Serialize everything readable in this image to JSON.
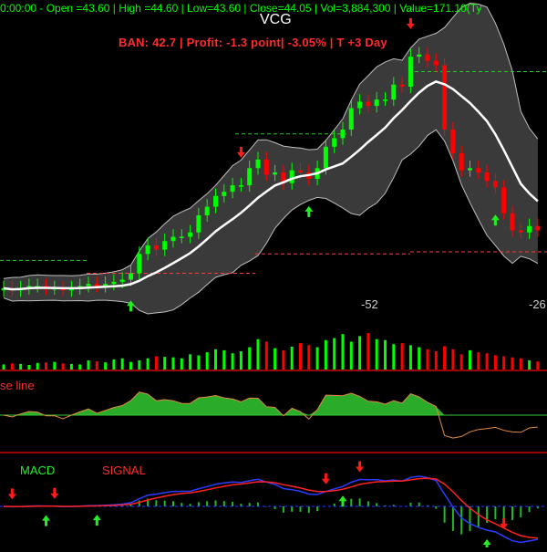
{
  "header": {
    "info_line": "0:00:00 -  Open =43.60 | High =44.60 | Low=43.60 | Close=44.05 | Vol=3,884,300 | Value=171.10(Ty",
    "symbol": "VCG",
    "signal_line": "BAN:  42.7 | Profit: -1.3 point| -3.05% | T +3 Day"
  },
  "colors": {
    "background": "#000000",
    "up_candle": "#00ff00",
    "down_candle": "#ff0000",
    "band_fill": "#3a3a3a",
    "band_edge": "#bfbfbf",
    "middle_band": "#ffffff",
    "macd_line": "#2a3cff",
    "signal_line": "#ff2020",
    "oscillator_line": "#e08a40",
    "oscillator_fill": "#2fbf2f",
    "buy_arrow": "#22ee22",
    "sell_arrow": "#ff1a1a"
  },
  "labels": {
    "base_line": "se line",
    "macd": "MACD",
    "signal": "SIGNAL",
    "annot_52": "-52",
    "annot_26": "-26"
  },
  "chart_data": {
    "type": "candlestick",
    "title": "VCG",
    "bars": 64,
    "close": [
      43.6,
      43.5,
      43.6,
      43.7,
      43.7,
      43.6,
      43.6,
      43.5,
      43.6,
      43.7,
      43.8,
      43.7,
      43.8,
      43.9,
      44.0,
      44.3,
      45.2,
      45.6,
      45.4,
      45.8,
      46.0,
      46.0,
      46.2,
      47.0,
      47.4,
      47.9,
      48.1,
      48.4,
      48.4,
      49.2,
      49.6,
      48.9,
      49.0,
      48.5,
      49.1,
      49.0,
      48.7,
      49.2,
      50.2,
      50.6,
      51.0,
      52.0,
      52.3,
      52.1,
      52.4,
      52.4,
      53.1,
      53.0,
      54.4,
      54.5,
      54.2,
      54.0,
      51.0,
      49.9,
      49.1,
      49.2,
      49.0,
      48.6,
      48.3,
      47.1,
      46.3,
      46.2,
      46.5,
      46.3
    ],
    "volume": [
      10,
      12,
      11,
      9,
      13,
      14,
      15,
      12,
      11,
      10,
      18,
      16,
      14,
      20,
      22,
      15,
      18,
      22,
      26,
      25,
      24,
      22,
      30,
      28,
      34,
      40,
      38,
      32,
      36,
      44,
      60,
      55,
      42,
      38,
      45,
      52,
      48,
      44,
      58,
      62,
      70,
      55,
      66,
      72,
      60,
      58,
      50,
      52,
      48,
      44,
      40,
      36,
      46,
      40,
      30,
      38,
      34,
      32,
      28,
      26,
      24,
      22,
      18,
      16
    ],
    "buy_signal_bars": [
      15,
      36,
      58
    ],
    "sell_signal_bars": [
      28,
      48
    ],
    "macd_buy_bars": [
      5,
      11,
      40,
      57
    ],
    "macd_sell_bars": [
      1,
      6,
      38,
      42,
      59
    ]
  }
}
